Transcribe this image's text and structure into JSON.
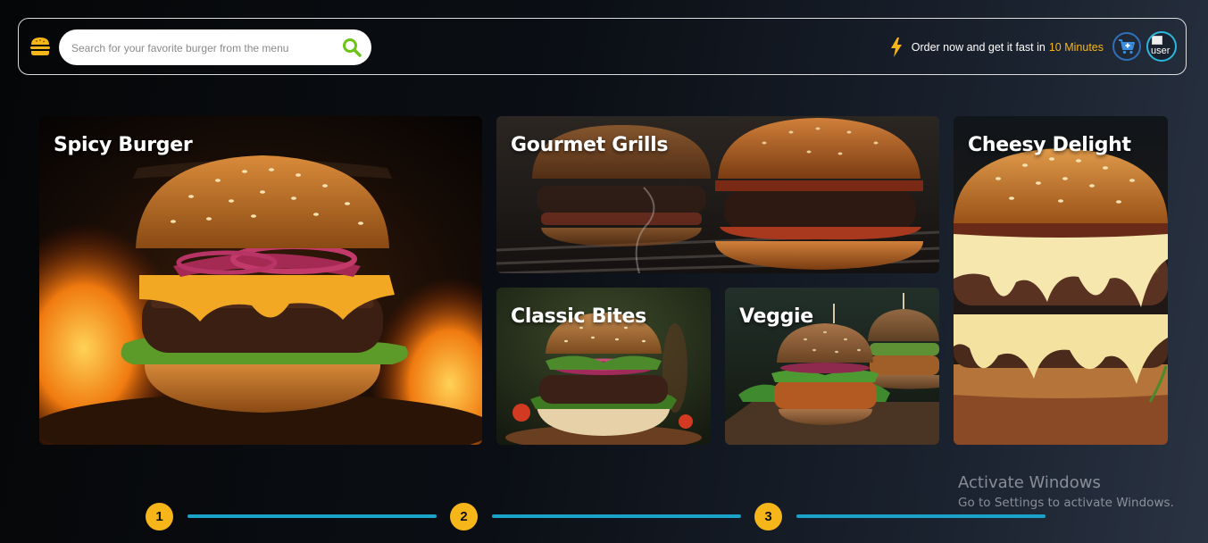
{
  "header": {
    "logo_icon": "burger-icon",
    "search": {
      "placeholder": "Search for your favorite burger from the menu",
      "value": "",
      "icon": "search-icon"
    },
    "promo": {
      "icon": "lightning-bolt-icon",
      "text": "Order now and get it fast in",
      "highlight": "10 Minutes"
    },
    "cart_icon": "add-to-cart-icon",
    "avatar_alt": "user"
  },
  "cards": [
    {
      "id": "spicy",
      "title": "Spicy Burger"
    },
    {
      "id": "gourmet",
      "title": "Gourmet Grills"
    },
    {
      "id": "classic",
      "title": "Classic Bites"
    },
    {
      "id": "veggie",
      "title": "Veggie"
    },
    {
      "id": "cheesy",
      "title": "Cheesy Delight"
    }
  ],
  "stepper": {
    "steps": [
      "1",
      "2",
      "3"
    ]
  },
  "watermark": {
    "title": "Activate Windows",
    "subtitle": "Go to Settings to activate Windows."
  },
  "colors": {
    "accent_yellow": "#f6b61a",
    "search_icon_green": "#6cc416",
    "stepper_line": "#1aa2c8",
    "cart_border": "#2f6fb8",
    "avatar_border": "#2bb6e0"
  }
}
